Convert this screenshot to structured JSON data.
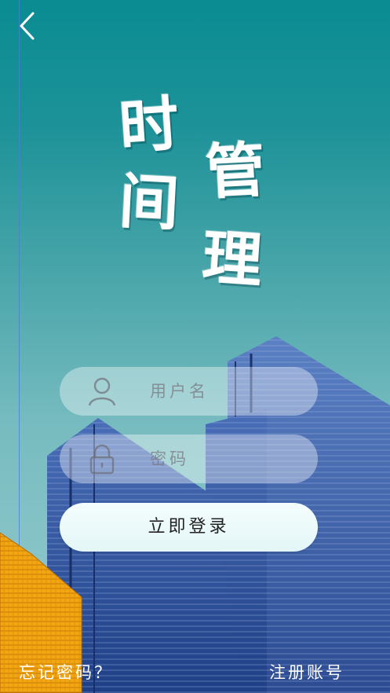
{
  "header": {
    "back_icon": "chevron-left-icon"
  },
  "title": {
    "char1": "时",
    "char2": "间",
    "char3": "管",
    "char4": "理"
  },
  "login_form": {
    "username_placeholder": "用户名",
    "password_placeholder": "密码",
    "login_label": "立即登录",
    "user_icon": "user-icon",
    "lock_icon": "lock-icon"
  },
  "footer": {
    "forgot_label": "忘记密码？",
    "register_label": "注册账号"
  },
  "colors": {
    "accent_teal": "#0a8c92",
    "building_blue": "#2a4f9a",
    "building_orange": "#f0a010"
  }
}
